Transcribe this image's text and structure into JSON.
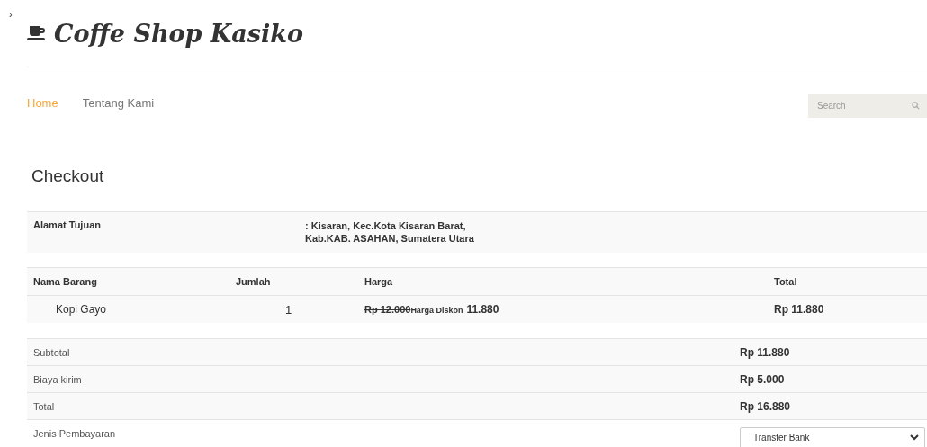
{
  "corner_mark": "›",
  "brand": {
    "name": "Coffe Shop Kasiko"
  },
  "nav": [
    {
      "label": "Home",
      "selected": true
    },
    {
      "label": "Tentang Kami",
      "selected": false
    }
  ],
  "search": {
    "placeholder": "Search"
  },
  "heading": "Checkout",
  "address": {
    "label": "Alamat Tujuan",
    "lines": [
      ": Kisaran, Kec.Kota Kisaran Barat,",
      "Kab.KAB. ASAHAN, Sumatera Utara"
    ]
  },
  "items_table": {
    "columns": [
      "Nama Barang",
      "Jumlah",
      "Harga",
      "Total"
    ],
    "rows": [
      {
        "name": "Kopi Gayo",
        "qty": "1",
        "old_price": "Rp 12.000",
        "discount_label": "Harga Diskon",
        "price": "11.880",
        "total": "Rp 11.880"
      }
    ]
  },
  "summary": [
    {
      "label": "Subtotal",
      "value": "Rp 11.880"
    },
    {
      "label": "Biaya kirim",
      "value": "Rp 5.000"
    },
    {
      "label": "Total",
      "value": "Rp 16.880"
    }
  ],
  "payment": {
    "label": "Jenis Pembayaran",
    "value": "Transfer Bank"
  }
}
